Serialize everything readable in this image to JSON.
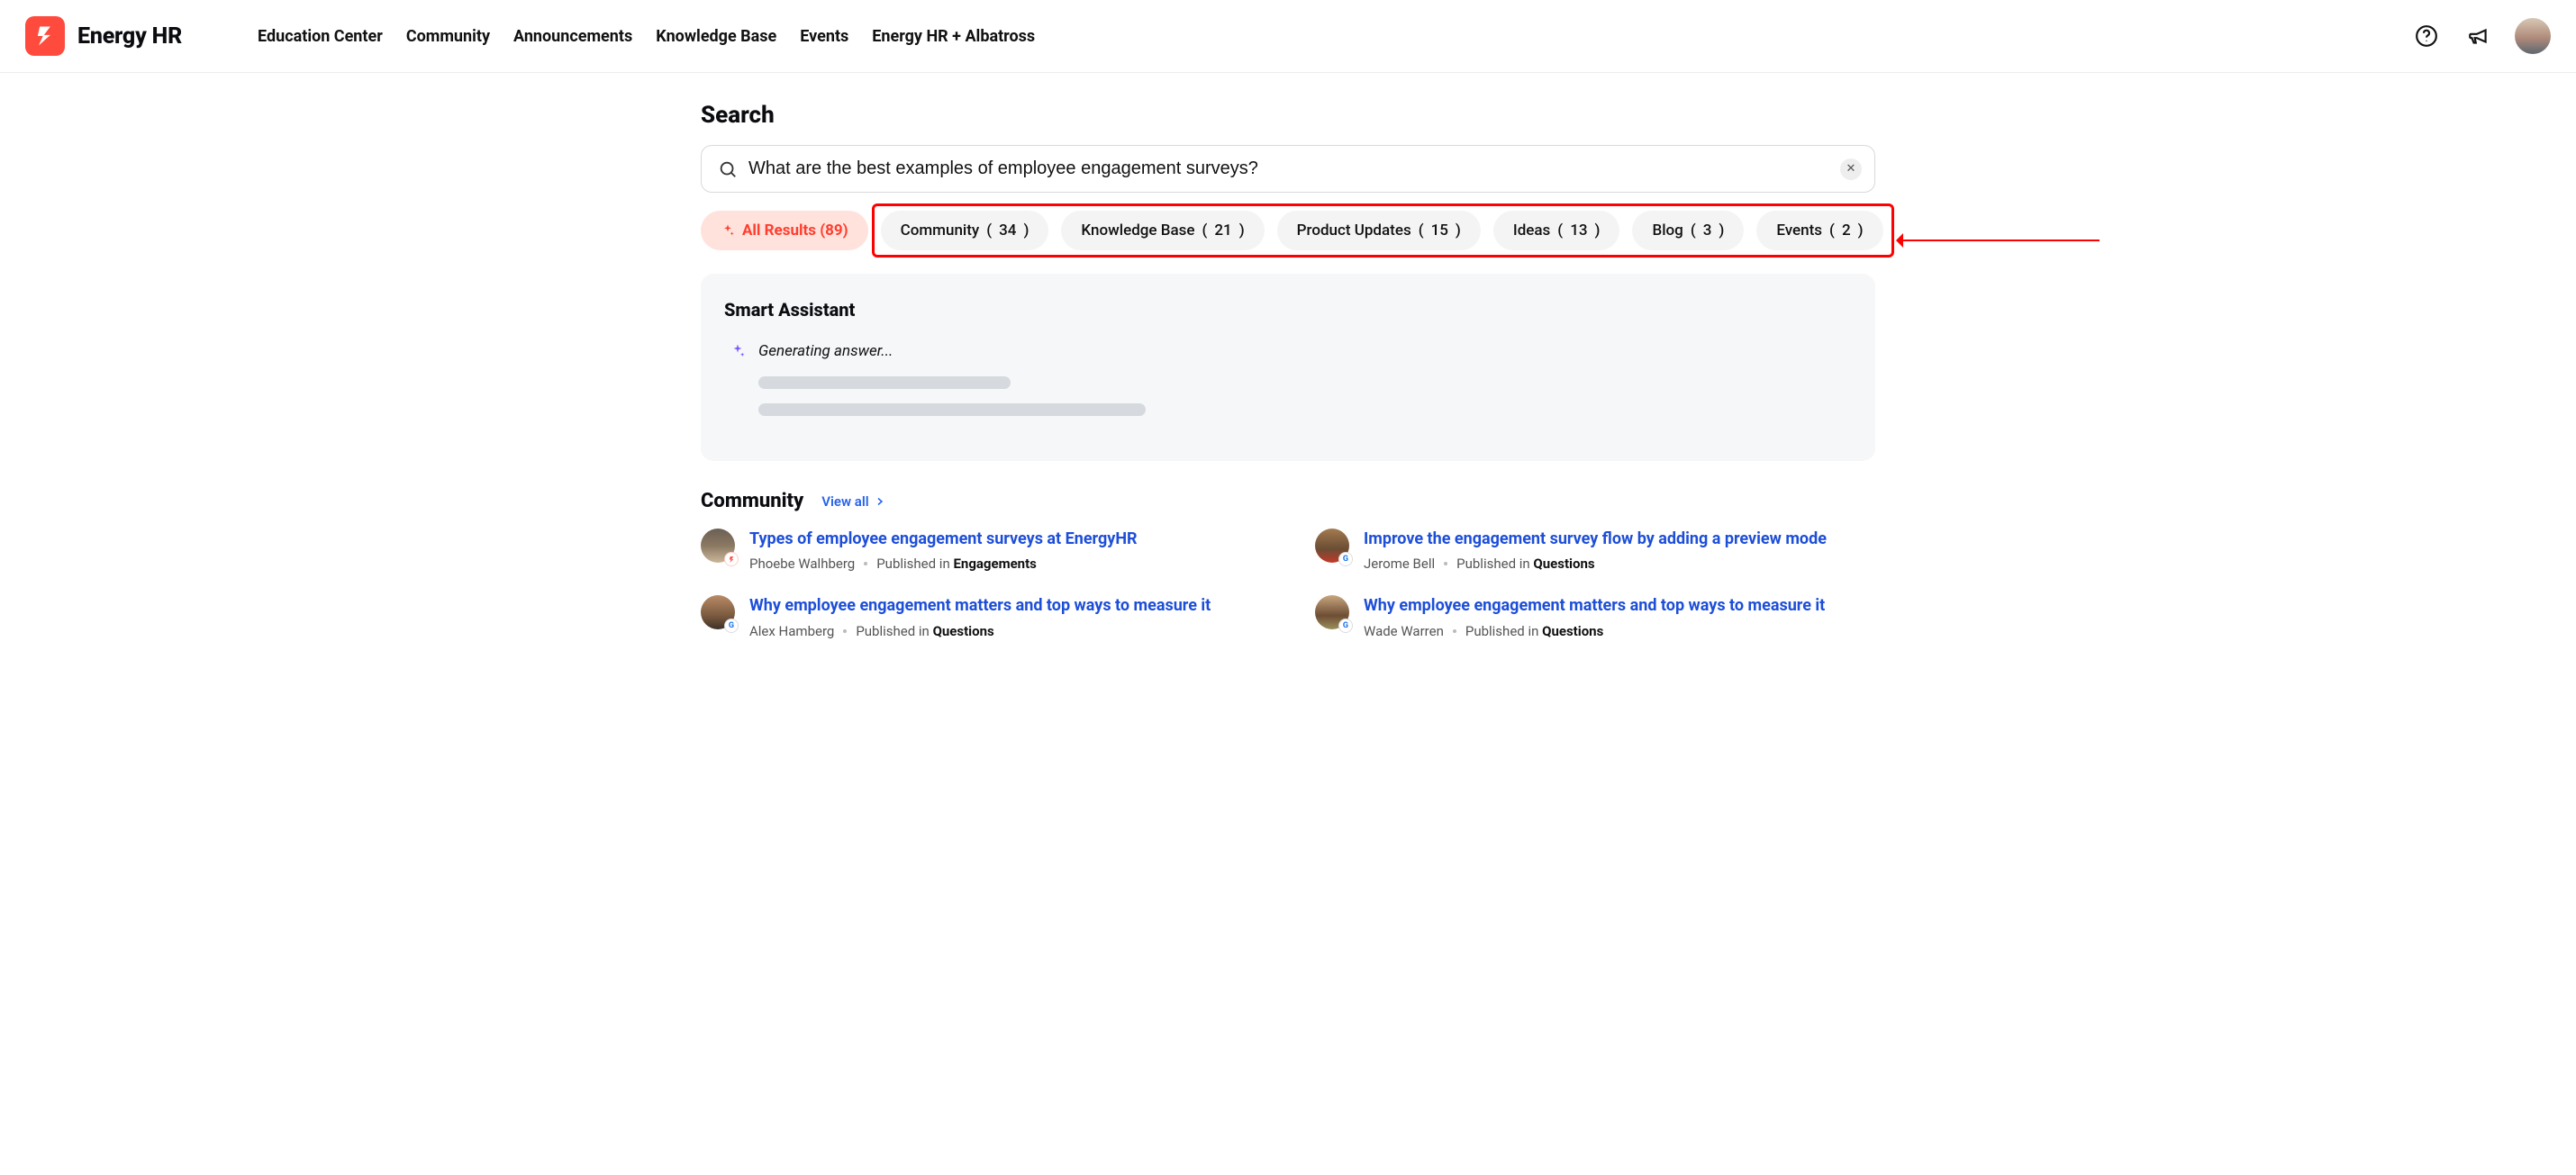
{
  "brand": {
    "name": "Energy HR"
  },
  "nav": {
    "items": [
      "Education Center",
      "Community",
      "Announcements",
      "Knowledge Base",
      "Events",
      "Energy HR + Albatross"
    ]
  },
  "page": {
    "title": "Search"
  },
  "search": {
    "value": "What are the best examples of employee engagement surveys?",
    "placeholder": "Search"
  },
  "filters": {
    "active": {
      "label": "All Results",
      "count": 89
    },
    "items": [
      {
        "label": "Community",
        "count": 34
      },
      {
        "label": "Knowledge Base",
        "count": 21
      },
      {
        "label": "Product Updates",
        "count": 15
      },
      {
        "label": "Ideas",
        "count": 13
      },
      {
        "label": "Blog",
        "count": 3
      },
      {
        "label": "Events",
        "count": 2
      }
    ]
  },
  "assistant": {
    "title": "Smart Assistant",
    "status": "Generating answer..."
  },
  "community_section": {
    "title": "Community",
    "view_all_label": "View all",
    "results": [
      {
        "title": "Types of employee engagement surveys at EnergyHR",
        "author": "Phoebe Walhberg",
        "pub_in": "Published in",
        "category": "Engagements",
        "avatar": "av1",
        "badge": "brand"
      },
      {
        "title": "Improve the engagement survey flow by adding a preview mode",
        "author": "Jerome Bell",
        "pub_in": "Published in",
        "category": "Questions",
        "avatar": "av3",
        "badge": "g"
      },
      {
        "title": "Why employee engagement matters and top ways to measure it",
        "author": "Alex Hamberg",
        "pub_in": "Published in",
        "category": "Questions",
        "avatar": "av2",
        "badge": "g"
      },
      {
        "title": "Why employee engagement matters and top ways to measure it",
        "author": "Wade Warren",
        "pub_in": "Published in",
        "category": "Questions",
        "avatar": "av4",
        "badge": "g"
      }
    ]
  }
}
